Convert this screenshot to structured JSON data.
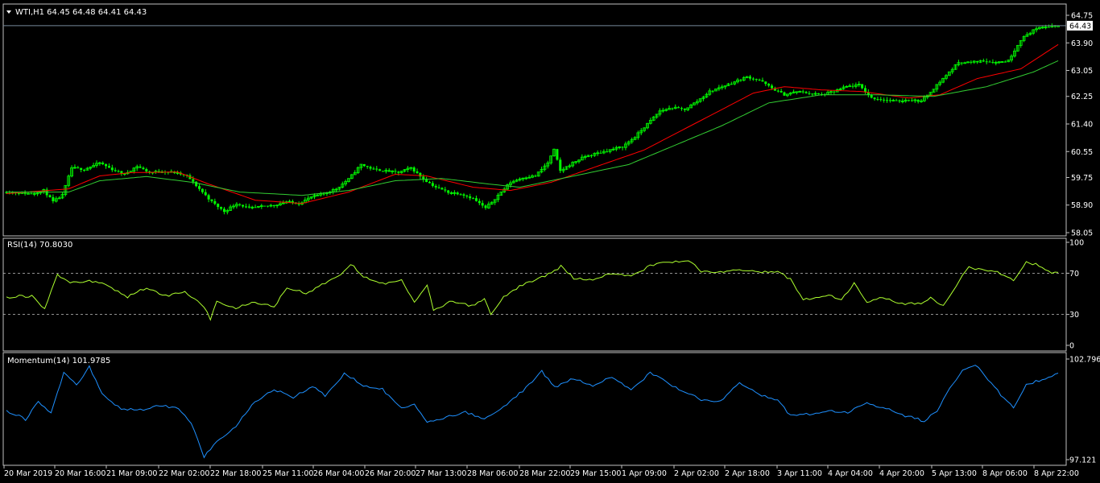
{
  "window": {
    "symbol_header": "WTI,H1  64.45 64.48 64.41 64.43",
    "bid_label": "64.43",
    "collapse_icon": "triangle-down-icon"
  },
  "colors": {
    "background": "#000000",
    "frame": "#C0C0C0",
    "bull_candle": "#00FF00",
    "bear_candle": "#00FF00",
    "ma_fast": "#FF0000",
    "ma_slow": "#32CD32",
    "rsi_line": "#ADFF2F",
    "momentum_line": "#1E90FF",
    "level_lines": "#C0C0C0",
    "bid_line": "#778899"
  },
  "chart_data": [
    {
      "type": "candlestick",
      "title": "WTI,H1  64.45 64.48 64.41 64.43",
      "ylim": [
        58.05,
        64.75
      ],
      "y_ticks": [
        "64.75",
        "63.90",
        "63.05",
        "62.25",
        "61.40",
        "60.55",
        "59.75",
        "58.90",
        "58.05"
      ],
      "x_ticks": [
        "20 Mar 2019",
        "20 Mar 16:00",
        "21 Mar 09:00",
        "22 Mar 02:00",
        "22 Mar 18:00",
        "25 Mar 11:00",
        "26 Mar 04:00",
        "26 Mar 20:00",
        "27 Mar 13:00",
        "28 Mar 06:00",
        "28 Mar 22:00",
        "29 Mar 15:00",
        "1 Apr 09:00",
        "2 Apr 02:00",
        "2 Apr 18:00",
        "3 Apr 11:00",
        "4 Apr 04:00",
        "4 Apr 20:00",
        "5 Apr 13:00",
        "8 Apr 06:00",
        "8 Apr 22:00"
      ],
      "last_price": 64.43,
      "close_anchors": [
        [
          0,
          59.3
        ],
        [
          8,
          59.25
        ],
        [
          12,
          59.35
        ],
        [
          15,
          59.0
        ],
        [
          18,
          59.2
        ],
        [
          21,
          60.05
        ],
        [
          25,
          60.0
        ],
        [
          30,
          60.2
        ],
        [
          34,
          60.0
        ],
        [
          38,
          59.85
        ],
        [
          42,
          60.1
        ],
        [
          46,
          59.9
        ],
        [
          50,
          59.95
        ],
        [
          54,
          59.9
        ],
        [
          58,
          59.8
        ],
        [
          62,
          59.4
        ],
        [
          66,
          59.0
        ],
        [
          70,
          58.7
        ],
        [
          74,
          58.95
        ],
        [
          78,
          58.8
        ],
        [
          82,
          58.85
        ],
        [
          86,
          58.9
        ],
        [
          90,
          59.0
        ],
        [
          94,
          58.95
        ],
        [
          98,
          59.15
        ],
        [
          102,
          59.25
        ],
        [
          106,
          59.4
        ],
        [
          110,
          59.7
        ],
        [
          114,
          60.15
        ],
        [
          118,
          60.0
        ],
        [
          122,
          59.95
        ],
        [
          126,
          59.9
        ],
        [
          130,
          60.05
        ],
        [
          134,
          59.7
        ],
        [
          138,
          59.45
        ],
        [
          142,
          59.3
        ],
        [
          146,
          59.25
        ],
        [
          150,
          59.1
        ],
        [
          154,
          58.8
        ],
        [
          158,
          59.2
        ],
        [
          162,
          59.6
        ],
        [
          166,
          59.75
        ],
        [
          170,
          59.8
        ],
        [
          174,
          60.2
        ],
        [
          176,
          60.6
        ],
        [
          178,
          59.95
        ],
        [
          182,
          60.2
        ],
        [
          186,
          60.4
        ],
        [
          190,
          60.5
        ],
        [
          194,
          60.6
        ],
        [
          198,
          60.7
        ],
        [
          202,
          61.0
        ],
        [
          206,
          61.4
        ],
        [
          210,
          61.8
        ],
        [
          214,
          61.9
        ],
        [
          218,
          61.85
        ],
        [
          222,
          62.1
        ],
        [
          226,
          62.4
        ],
        [
          230,
          62.55
        ],
        [
          234,
          62.7
        ],
        [
          238,
          62.85
        ],
        [
          242,
          62.75
        ],
        [
          246,
          62.5
        ],
        [
          250,
          62.3
        ],
        [
          254,
          62.4
        ],
        [
          258,
          62.35
        ],
        [
          262,
          62.3
        ],
        [
          266,
          62.4
        ],
        [
          270,
          62.55
        ],
        [
          274,
          62.6
        ],
        [
          278,
          62.2
        ],
        [
          282,
          62.15
        ],
        [
          286,
          62.1
        ],
        [
          290,
          62.15
        ],
        [
          294,
          62.1
        ],
        [
          298,
          62.5
        ],
        [
          302,
          62.9
        ],
        [
          306,
          63.3
        ],
        [
          310,
          63.3
        ],
        [
          314,
          63.35
        ],
        [
          318,
          63.3
        ],
        [
          322,
          63.35
        ],
        [
          326,
          64.0
        ],
        [
          330,
          64.3
        ],
        [
          334,
          64.4
        ],
        [
          338,
          64.43
        ]
      ],
      "series": [
        {
          "name": "",
          "kind": "moving-average-fast",
          "anchors": [
            [
              0,
              59.25
            ],
            [
              20,
              59.4
            ],
            [
              30,
              59.8
            ],
            [
              40,
              59.9
            ],
            [
              55,
              59.92
            ],
            [
              65,
              59.55
            ],
            [
              80,
              59.05
            ],
            [
              95,
              58.95
            ],
            [
              110,
              59.3
            ],
            [
              125,
              59.85
            ],
            [
              135,
              59.8
            ],
            [
              150,
              59.45
            ],
            [
              162,
              59.35
            ],
            [
              175,
              59.6
            ],
            [
              190,
              60.1
            ],
            [
              205,
              60.6
            ],
            [
              215,
              61.1
            ],
            [
              230,
              61.85
            ],
            [
              240,
              62.35
            ],
            [
              250,
              62.55
            ],
            [
              262,
              62.45
            ],
            [
              275,
              62.4
            ],
            [
              290,
              62.2
            ],
            [
              300,
              62.3
            ],
            [
              312,
              62.8
            ],
            [
              326,
              63.1
            ],
            [
              338,
              63.85
            ]
          ]
        },
        {
          "name": "",
          "kind": "moving-average-slow",
          "anchors": [
            [
              0,
              59.3
            ],
            [
              20,
              59.3
            ],
            [
              30,
              59.65
            ],
            [
              45,
              59.78
            ],
            [
              60,
              59.6
            ],
            [
              75,
              59.3
            ],
            [
              95,
              59.2
            ],
            [
              110,
              59.35
            ],
            [
              125,
              59.65
            ],
            [
              140,
              59.72
            ],
            [
              155,
              59.55
            ],
            [
              165,
              59.45
            ],
            [
              180,
              59.75
            ],
            [
              200,
              60.15
            ],
            [
              215,
              60.75
            ],
            [
              230,
              61.35
            ],
            [
              245,
              62.05
            ],
            [
              262,
              62.3
            ],
            [
              280,
              62.3
            ],
            [
              298,
              62.25
            ],
            [
              315,
              62.55
            ],
            [
              330,
              63.0
            ],
            [
              338,
              63.35
            ]
          ]
        }
      ]
    },
    {
      "type": "line",
      "title": "RSI(14) 70.8030",
      "ylim": [
        0,
        100
      ],
      "y_ticks": [
        "100",
        "70",
        "30",
        "0"
      ],
      "levels": [
        30,
        70
      ],
      "series": [
        {
          "name": "RSI(14)",
          "anchors": [
            [
              0,
              47
            ],
            [
              8,
              48
            ],
            [
              12,
              35
            ],
            [
              16,
              68
            ],
            [
              20,
              60
            ],
            [
              26,
              63
            ],
            [
              32,
              58
            ],
            [
              38,
              47
            ],
            [
              44,
              56
            ],
            [
              50,
              48
            ],
            [
              56,
              52
            ],
            [
              62,
              38
            ],
            [
              64,
              25
            ],
            [
              66,
              42
            ],
            [
              72,
              36
            ],
            [
              78,
              42
            ],
            [
              84,
              38
            ],
            [
              88,
              55
            ],
            [
              94,
              51
            ],
            [
              100,
              60
            ],
            [
              106,
              72
            ],
            [
              108,
              79
            ],
            [
              112,
              67
            ],
            [
              118,
              60
            ],
            [
              124,
              63
            ],
            [
              128,
              41
            ],
            [
              132,
              58
            ],
            [
              134,
              34
            ],
            [
              140,
              43
            ],
            [
              146,
              38
            ],
            [
              150,
              45
            ],
            [
              152,
              30
            ],
            [
              156,
              47
            ],
            [
              162,
              59
            ],
            [
              168,
              66
            ],
            [
              172,
              72
            ],
            [
              174,
              77
            ],
            [
              178,
              65
            ],
            [
              184,
              64
            ],
            [
              190,
              70
            ],
            [
              196,
              68
            ],
            [
              202,
              77
            ],
            [
              208,
              81
            ],
            [
              214,
              82
            ],
            [
              218,
              72
            ],
            [
              224,
              71
            ],
            [
              230,
              74
            ],
            [
              236,
              71
            ],
            [
              242,
              72
            ],
            [
              246,
              64
            ],
            [
              250,
              44
            ],
            [
              254,
              47
            ],
            [
              258,
              49
            ],
            [
              262,
              45
            ],
            [
              266,
              60
            ],
            [
              270,
              41
            ],
            [
              274,
              47
            ],
            [
              280,
              41
            ],
            [
              286,
              40
            ],
            [
              290,
              46
            ],
            [
              294,
              39
            ],
            [
              298,
              58
            ],
            [
              302,
              76
            ],
            [
              306,
              73
            ],
            [
              312,
              70
            ],
            [
              316,
              62
            ],
            [
              320,
              80
            ],
            [
              324,
              78
            ],
            [
              328,
              71
            ],
            [
              330,
              70.8
            ]
          ]
        }
      ]
    },
    {
      "type": "line",
      "title": "Momentum(14) 101.9785",
      "ylim": [
        97.121,
        102.7963
      ],
      "y_ticks": [
        "102.7963",
        "97.121"
      ],
      "series": [
        {
          "name": "Momentum(14)",
          "anchors": [
            [
              0,
              99.9
            ],
            [
              6,
              99.4
            ],
            [
              10,
              100.4
            ],
            [
              14,
              99.7
            ],
            [
              18,
              102.0
            ],
            [
              22,
              101.3
            ],
            [
              26,
              102.4
            ],
            [
              30,
              100.8
            ],
            [
              36,
              100.0
            ],
            [
              42,
              99.9
            ],
            [
              48,
              100.2
            ],
            [
              54,
              100.0
            ],
            [
              58,
              99.2
            ],
            [
              62,
              97.3
            ],
            [
              66,
              98.1
            ],
            [
              72,
              99.0
            ],
            [
              78,
              100.4
            ],
            [
              84,
              101.1
            ],
            [
              90,
              100.6
            ],
            [
              96,
              101.3
            ],
            [
              100,
              100.7
            ],
            [
              106,
              102.0
            ],
            [
              112,
              101.3
            ],
            [
              118,
              101.1
            ],
            [
              124,
              100.0
            ],
            [
              128,
              100.2
            ],
            [
              132,
              99.2
            ],
            [
              138,
              99.5
            ],
            [
              144,
              99.8
            ],
            [
              150,
              99.4
            ],
            [
              156,
              100.1
            ],
            [
              162,
              101.0
            ],
            [
              168,
              102.1
            ],
            [
              172,
              101.2
            ],
            [
              178,
              101.7
            ],
            [
              184,
              101.3
            ],
            [
              190,
              101.8
            ],
            [
              196,
              101.1
            ],
            [
              202,
              102.0
            ],
            [
              206,
              101.6
            ],
            [
              212,
              101.0
            ],
            [
              218,
              100.5
            ],
            [
              224,
              100.4
            ],
            [
              230,
              101.5
            ],
            [
              236,
              100.8
            ],
            [
              242,
              100.5
            ],
            [
              246,
              99.6
            ],
            [
              252,
              99.7
            ],
            [
              258,
              99.9
            ],
            [
              264,
              99.8
            ],
            [
              270,
              100.3
            ],
            [
              276,
              100.0
            ],
            [
              282,
              99.6
            ],
            [
              288,
              99.3
            ],
            [
              292,
              99.9
            ],
            [
              296,
              101.2
            ],
            [
              300,
              102.1
            ],
            [
              304,
              102.5
            ],
            [
              308,
              101.6
            ],
            [
              312,
              100.8
            ],
            [
              316,
              100.0
            ],
            [
              320,
              101.3
            ],
            [
              324,
              101.6
            ],
            [
              330,
              102.0
            ]
          ]
        }
      ]
    }
  ]
}
